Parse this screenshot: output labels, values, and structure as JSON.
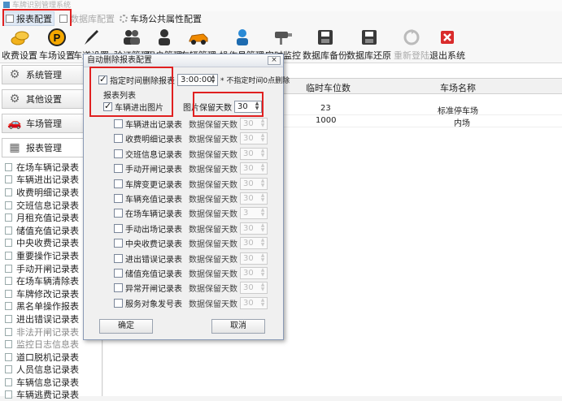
{
  "window": {
    "title": "车牌识别管理系统"
  },
  "menu": {
    "items": [
      {
        "label": "报表配置"
      },
      {
        "label": "数据库配置"
      },
      {
        "label": "车场公共属性配置"
      }
    ]
  },
  "toolbar": {
    "items": [
      {
        "label": "收费设置",
        "icon": "coins-icon"
      },
      {
        "label": "车场设置",
        "icon": "parking-icon"
      },
      {
        "label": "车道设置",
        "icon": "pen-icon"
      },
      {
        "label": "验证管理",
        "icon": "users-icon"
      },
      {
        "label": "用户管理",
        "icon": "user-icon"
      },
      {
        "label": "车辆管理",
        "icon": "car-icon"
      },
      {
        "label": "操作员管理",
        "icon": "operator-icon"
      },
      {
        "label": "实时监控",
        "icon": "camera-icon"
      },
      {
        "label": "数据库备份",
        "icon": "db-backup-icon"
      },
      {
        "label": "数据库还原",
        "icon": "db-restore-icon"
      },
      {
        "label": "重新登陆",
        "icon": "refresh-icon"
      },
      {
        "label": "退出系统",
        "icon": "exit-icon"
      }
    ]
  },
  "sidebar": {
    "sections": [
      {
        "label": "系统管理"
      },
      {
        "label": "其他设置"
      },
      {
        "label": "车场管理"
      },
      {
        "label": "报表管理"
      }
    ],
    "reports": [
      "在场车辆记录表",
      "车辆进出记录表",
      "收费明细记录表",
      "交班信息记录表",
      "月租充值记录表",
      "储值充值记录表",
      "中央收费记录表",
      "重要操作记录表",
      "手动开闸记录表",
      "在场车辆清除表",
      "车牌修改记录表",
      "黑名单操作报表",
      "进出错误记录表",
      "非法开闸记录表",
      "监控日志信息表",
      "道口脱机记录表",
      "人员信息记录表",
      "车辆信息记录表",
      "车辆逃费记录表"
    ]
  },
  "grid": {
    "headers": [
      "临时车位数",
      "车场名称"
    ],
    "rows": [
      {
        "spaces": "23",
        "name": "标准停车场"
      },
      {
        "spaces": "1000",
        "name": "内场"
      }
    ]
  },
  "dialog": {
    "title": "自动删除报表配置",
    "close": "×",
    "timed_delete_label": "指定时间删除报表",
    "time_value": "3:00:00",
    "note": "* 不指定时间0点删除",
    "group_label": "报表列表",
    "image_row": {
      "label": "车辆进出图片",
      "days_label": "图片保留天数",
      "days": "30"
    },
    "report_rows": [
      {
        "label": "车辆进出记录表",
        "days_label": "数据保留天数",
        "days": "30"
      },
      {
        "label": "收费明细记录表",
        "days_label": "数据保留天数",
        "days": "30"
      },
      {
        "label": "交班信息记录表",
        "days_label": "数据保留天数",
        "days": "30"
      },
      {
        "label": "手动开闸记录表",
        "days_label": "数据保留天数",
        "days": "30"
      },
      {
        "label": "车牌变更记录表",
        "days_label": "数据保留天数",
        "days": "30"
      },
      {
        "label": "车辆充值记录表",
        "days_label": "数据保留天数",
        "days": "30"
      },
      {
        "label": "在场车辆记录表",
        "days_label": "数据保留天数",
        "days": "3"
      },
      {
        "label": "手动出场记录表",
        "days_label": "数据保留天数",
        "days": "30"
      },
      {
        "label": "中央收费记录表",
        "days_label": "数据保留天数",
        "days": "30"
      },
      {
        "label": "进出错误记录表",
        "days_label": "数据保留天数",
        "days": "30"
      },
      {
        "label": "储值充值记录表",
        "days_label": "数据保留天数",
        "days": "30"
      },
      {
        "label": "异常开闸记录表",
        "days_label": "数据保留天数",
        "days": "30"
      },
      {
        "label": "服务对象发号表",
        "days_label": "数据保留天数",
        "days": "30"
      }
    ],
    "ok": "确定",
    "cancel": "取消"
  },
  "colors": {
    "highlight": "#e02020",
    "accent": "#4a90c8"
  }
}
